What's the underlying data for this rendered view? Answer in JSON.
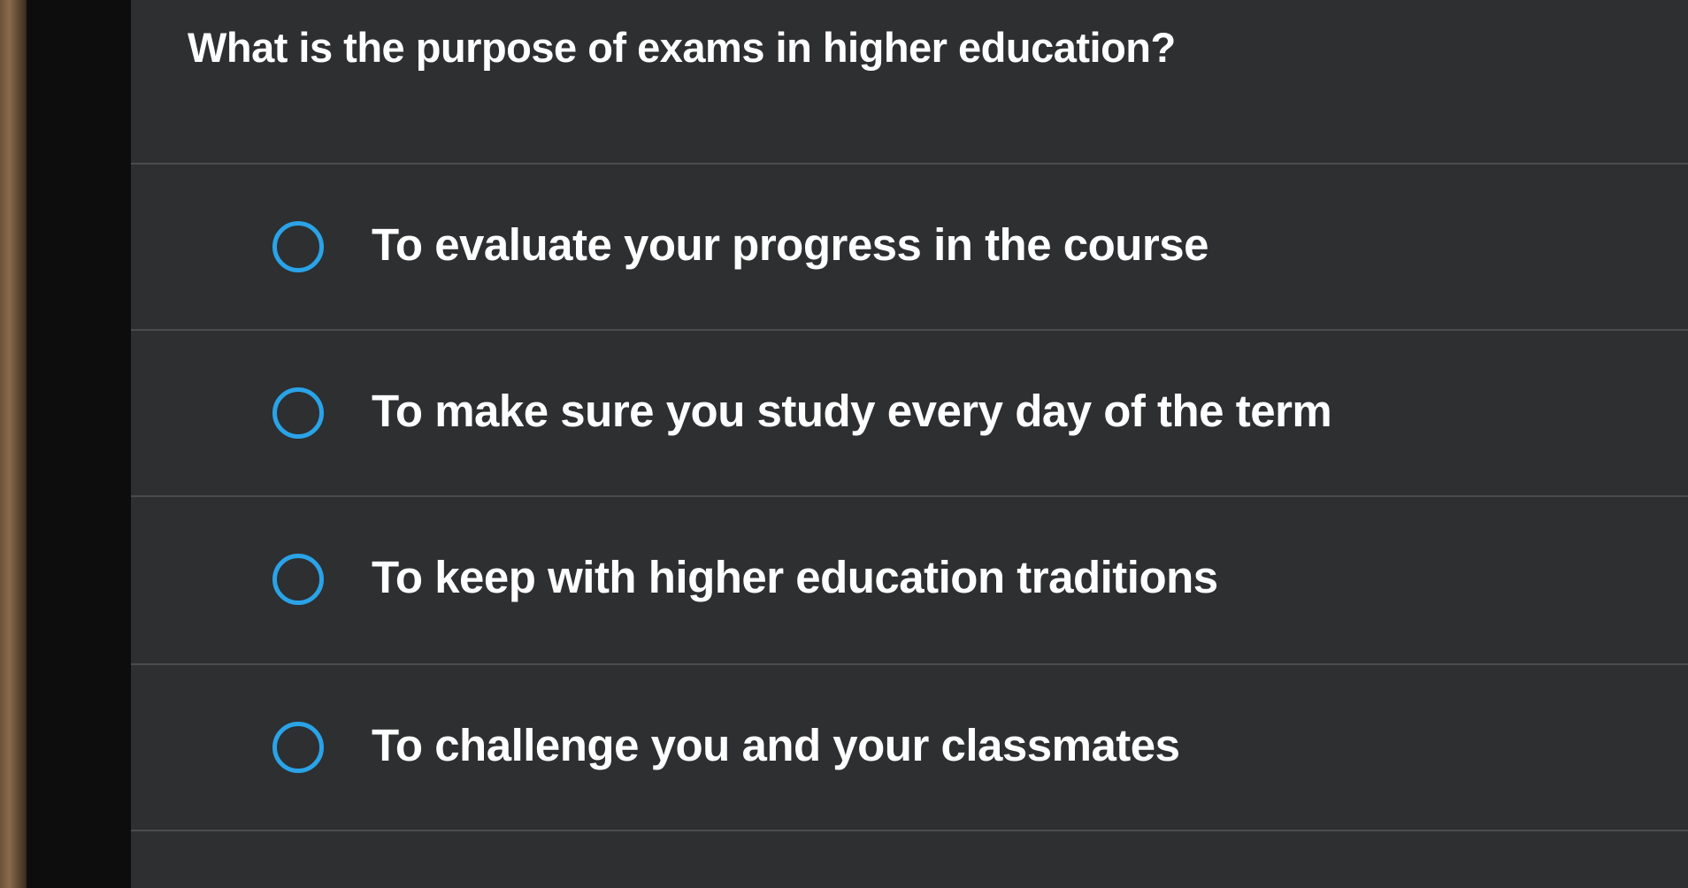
{
  "quiz": {
    "question": "What is the purpose of exams in higher education?",
    "options": [
      {
        "label": "To evaluate your progress in the course",
        "selected": false
      },
      {
        "label": "To make sure you study every day of the term",
        "selected": false
      },
      {
        "label": "To keep with higher education traditions",
        "selected": false
      },
      {
        "label": "To challenge you and your classmates",
        "selected": false
      }
    ]
  },
  "colors": {
    "background": "#2d2f31",
    "radio_accent": "#2aa3e8",
    "text": "#ffffff",
    "divider": "#4a4c4e"
  }
}
